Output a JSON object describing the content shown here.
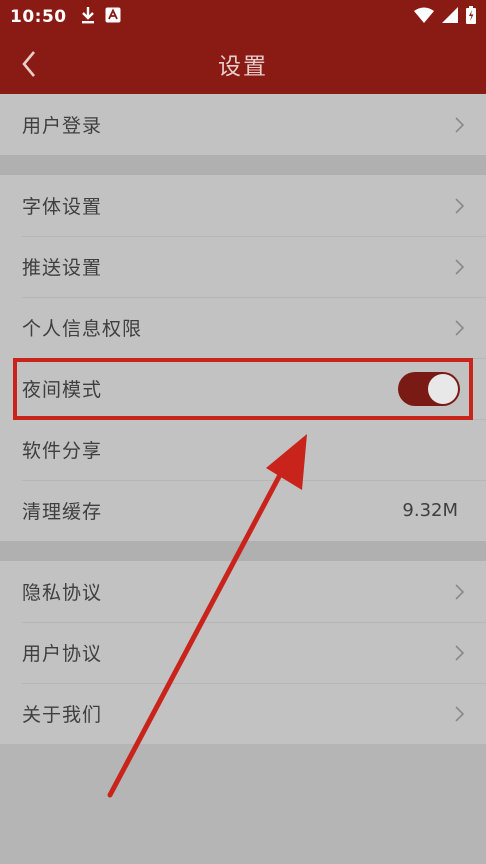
{
  "status_bar": {
    "time": "10:50",
    "icons": [
      "download-icon",
      "a-notification-icon",
      "wifi-icon",
      "signal-icon",
      "battery-icon"
    ]
  },
  "app_bar": {
    "title": "设置",
    "back_icon": "chevron-left-icon"
  },
  "groups": [
    {
      "items": [
        {
          "label": "用户登录",
          "trailing": "chevron"
        }
      ]
    },
    {
      "items": [
        {
          "label": "字体设置",
          "trailing": "chevron"
        },
        {
          "label": "推送设置",
          "trailing": "chevron"
        },
        {
          "label": "个人信息权限",
          "trailing": "chevron"
        },
        {
          "label": "夜间模式",
          "trailing": "toggle",
          "toggle_on": true
        },
        {
          "label": "软件分享",
          "trailing": "none"
        },
        {
          "label": "清理缓存",
          "trailing": "value",
          "value": "9.32M"
        }
      ]
    },
    {
      "items": [
        {
          "label": "隐私协议",
          "trailing": "chevron"
        },
        {
          "label": "用户协议",
          "trailing": "chevron"
        },
        {
          "label": "关于我们",
          "trailing": "chevron"
        }
      ]
    }
  ],
  "colors": {
    "brand": "#8a1a14",
    "highlight": "#c8241c",
    "toggle_on": "#7a1a14"
  }
}
